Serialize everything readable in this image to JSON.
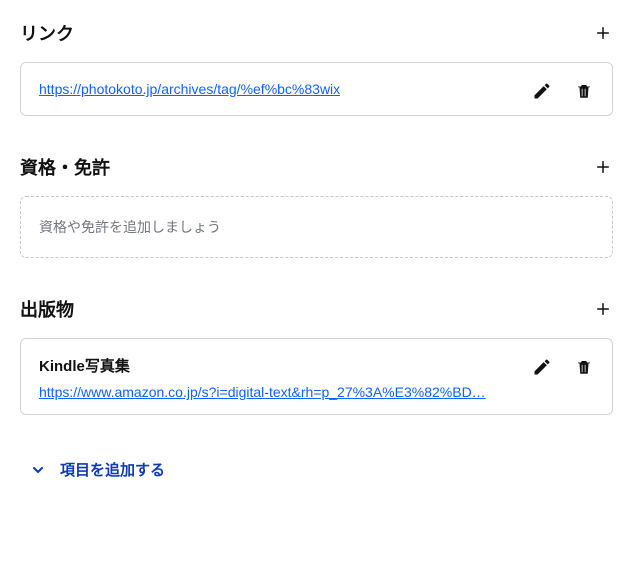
{
  "sections": {
    "links": {
      "title": "リンク",
      "items": [
        {
          "url": "https://photokoto.jp/archives/tag/%ef%bc%83wix"
        }
      ]
    },
    "licenses": {
      "title": "資格・免許",
      "placeholder": "資格や免許を追加しましょう"
    },
    "publications": {
      "title": "出版物",
      "items": [
        {
          "title": "Kindle写真集",
          "url": "https://www.amazon.co.jp/s?i=digital-text&rh=p_27%3A%E3%82%BD…"
        }
      ]
    }
  },
  "footer": {
    "add_section_label": "項目を追加する"
  }
}
